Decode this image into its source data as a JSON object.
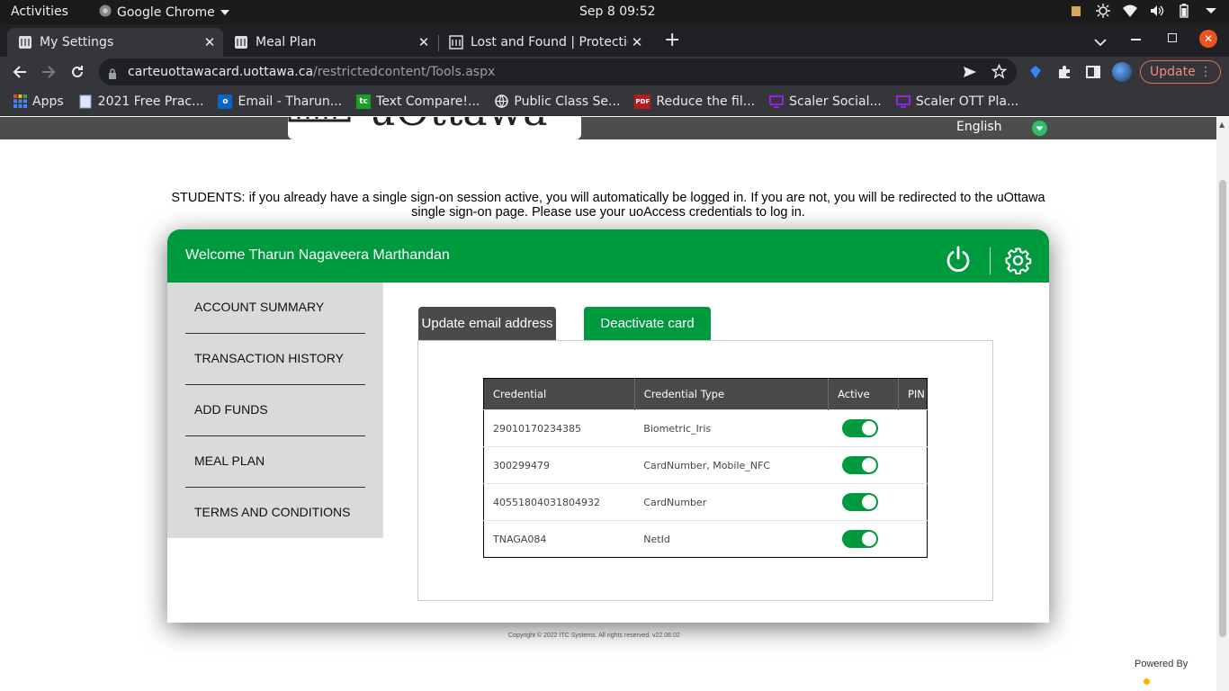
{
  "os_bar": {
    "activities": "Activities",
    "app_name": "Google Chrome",
    "clock": "Sep 8  09:52"
  },
  "browser": {
    "tabs": [
      {
        "title": "My Settings",
        "active": true
      },
      {
        "title": "Meal Plan",
        "active": false
      },
      {
        "title": "Lost and Found | Protection",
        "active": false
      }
    ],
    "url_host": "carteuottawacard.uottawa.ca",
    "url_path": "/restrictedcontent/Tools.aspx",
    "update_label": "Update",
    "bookmarks": [
      {
        "label": "Apps",
        "icon": "apps-grid-icon"
      },
      {
        "label": "2021 Free Prac...",
        "icon": "document-icon"
      },
      {
        "label": "Email - Tharun...",
        "icon": "outlook-icon"
      },
      {
        "label": "Text Compare!...",
        "icon": "text-compare-icon"
      },
      {
        "label": "Public Class Se...",
        "icon": "globe-icon"
      },
      {
        "label": "Reduce the fil...",
        "icon": "pdf-icon"
      },
      {
        "label": "Scaler Social...",
        "icon": "scaler-icon"
      },
      {
        "label": "Scaler OTT Pla...",
        "icon": "scaler-icon"
      }
    ]
  },
  "page": {
    "language": "English",
    "notice_line1": "STUDENTS: if you already have a single sign-on session active, you will automatically be logged in. If you are not, you will be redirected to the uOttawa",
    "notice_line2": "single sign-on page. Please use your uoAccess credentials to log in.",
    "welcome": "Welcome Tharun Nagaveera Marthandan",
    "nav": [
      "ACCOUNT SUMMARY",
      "TRANSACTION HISTORY",
      "ADD FUNDS",
      "MEAL PLAN",
      "TERMS AND CONDITIONS"
    ],
    "tab_update_email": "Update email address",
    "tab_deactivate": "Deactivate card",
    "table": {
      "headers": [
        "Credential",
        "Credential Type",
        "Active",
        "PIN"
      ],
      "rows": [
        {
          "credential": "29010170234385",
          "type": "Biometric_Iris",
          "active": true
        },
        {
          "credential": "300299479",
          "type": "CardNumber, Mobile_NFC",
          "active": true
        },
        {
          "credential": "40551804031804932",
          "type": "CardNumber",
          "active": true
        },
        {
          "credential": "TNAGA084",
          "type": "NetId",
          "active": true
        }
      ]
    },
    "copyright": "Copyright © 2022 ITC Systems. All rights reserved. v22.06.02",
    "powered_by": "Powered By"
  },
  "colors": {
    "brand_green": "#009a3e",
    "tab_dark": "#4a4a4a",
    "chrome_dark": "#202124"
  }
}
